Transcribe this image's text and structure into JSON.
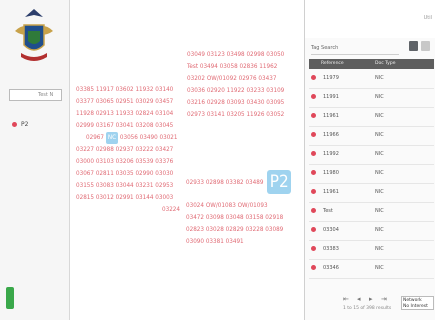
{
  "sidebar": {
    "search_value": "Test",
    "search_suffix": "N",
    "nav_item": "P2"
  },
  "cloud": {
    "block1": [
      "03385 11917 03602 11932 03140",
      "03377 03065 02951 03029 03457",
      "11928 02913 11933 02824 03104",
      "02999 03167 03041 03208 03045"
    ],
    "block1_line5_pre": "02967",
    "block1_chip": "NC",
    "block1_line5_post": "03056 03490 03021",
    "block1_tail": [
      "03227 02988 02937 03222 03427",
      "03000 03103 03206 03539 03376",
      "03067 02811 03035 02990 03030",
      "03155 03083 03044 03231 02953",
      "02815 03012 02991 03144 03003",
      "03224"
    ],
    "block2": [
      "03049 03123 03498 02998 03050",
      "Test 03494 03058 02836 11962",
      "03202 OW/01092 02976 03437",
      "03036 02920 11922 03233 03109",
      "03216 02928 03093 03430 03095",
      "02973 03141 03205 11926 03052"
    ],
    "block3_pre": "02933 02898 03382 03489",
    "block3_chip": "P2",
    "block4": [
      "03024 OW/01083 OW/01093",
      "03472 03098 03048 03158 02918",
      "02823 03028 02829 03228 03089",
      "03090 03381 03491"
    ]
  },
  "panel": {
    "top_util": "Util",
    "tag_search_label": "Tag Search",
    "col1": "Reference",
    "col2": "Doc Type",
    "rows": [
      {
        "id": "11979",
        "type": "NIC"
      },
      {
        "id": "11991",
        "type": "NIC"
      },
      {
        "id": "11961",
        "type": "NIC"
      },
      {
        "id": "11966",
        "type": "NIC"
      },
      {
        "id": "11992",
        "type": "NIC"
      },
      {
        "id": "11980",
        "type": "NIC"
      },
      {
        "id": "11961",
        "type": "NIC"
      },
      {
        "id": "Test",
        "type": "NIC"
      },
      {
        "id": "03304",
        "type": "NIC"
      },
      {
        "id": "03383",
        "type": "NIC"
      },
      {
        "id": "03346",
        "type": "NIC"
      }
    ],
    "pager_info": "1 to 15 of 398 results",
    "select_label": "Network",
    "select_value": "No Interest"
  }
}
